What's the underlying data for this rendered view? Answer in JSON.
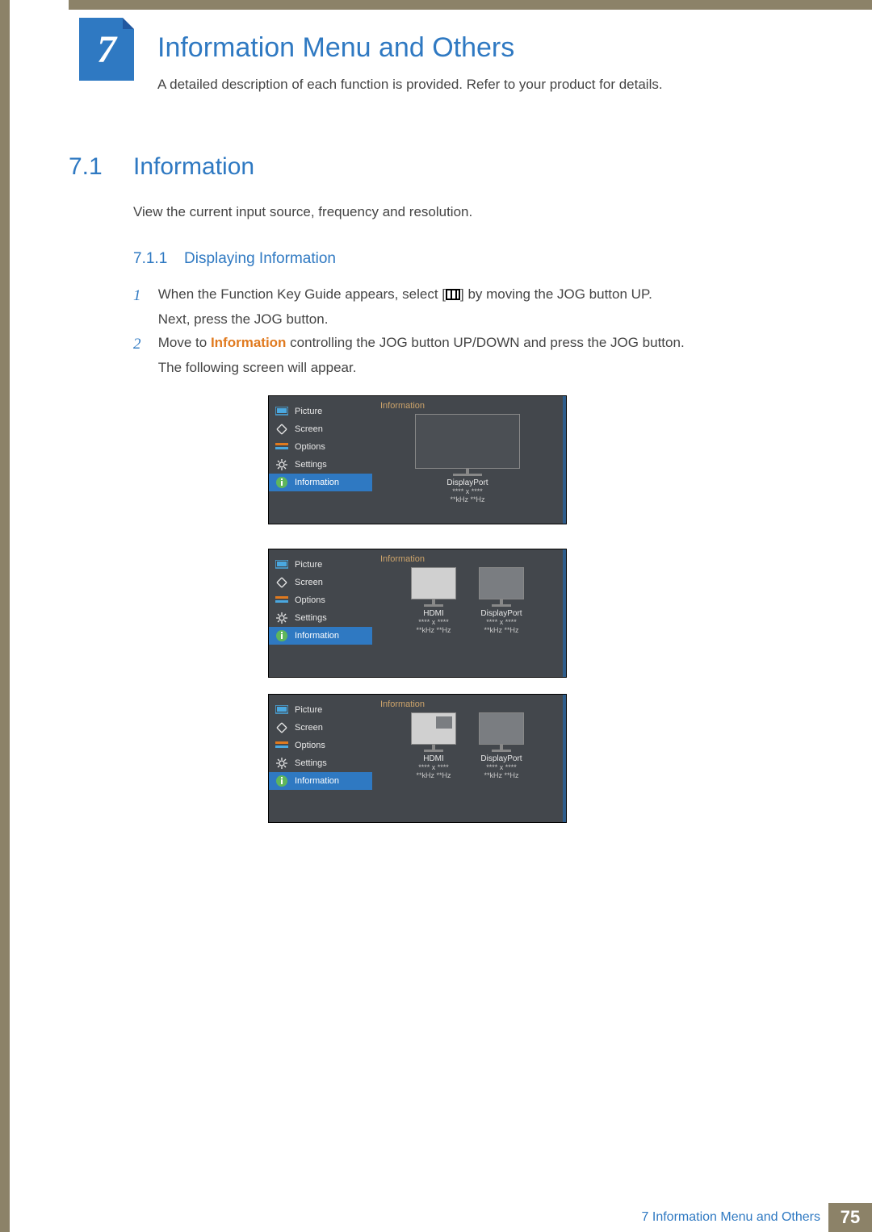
{
  "chapter": {
    "number": "7",
    "title": "Information Menu and Others",
    "description": "A detailed description of each function is provided. Refer to your product for details."
  },
  "section": {
    "number": "7.1",
    "title": "Information",
    "description": "View the current input source, frequency and resolution."
  },
  "subsection": {
    "number": "7.1.1",
    "title": "Displaying Information"
  },
  "steps": {
    "s1_num": "1",
    "s1_a": "When the Function Key Guide appears, select [",
    "s1_b": "] by moving the JOG button UP.",
    "s1_c": "Next, press the JOG button.",
    "s2_num": "2",
    "s2_a": "Move to ",
    "s2_hl": "Information",
    "s2_b": " controlling the JOG button UP/DOWN and press the JOG button.",
    "s2_c": "The following screen will appear."
  },
  "osd": {
    "heading": "Information",
    "menu": {
      "picture": "Picture",
      "screen": "Screen",
      "options": "Options",
      "settings": "Settings",
      "information": "Information"
    },
    "panel1": {
      "source": "DisplayPort",
      "res": "**** x ****",
      "freq": "**kHz **Hz"
    },
    "panel2": {
      "left_source": "HDMI",
      "left_res": "**** x ****",
      "left_freq": "**kHz **Hz",
      "right_source": "DisplayPort",
      "right_res": "**** x ****",
      "right_freq": "**kHz **Hz"
    },
    "panel3": {
      "left_source": "HDMI",
      "left_res": "**** x ****",
      "left_freq": "**kHz **Hz",
      "right_source": "DisplayPort",
      "right_res": "**** x ****",
      "right_freq": "**kHz **Hz"
    }
  },
  "footer": {
    "text": "7 Information Menu and Others",
    "page": "75"
  }
}
